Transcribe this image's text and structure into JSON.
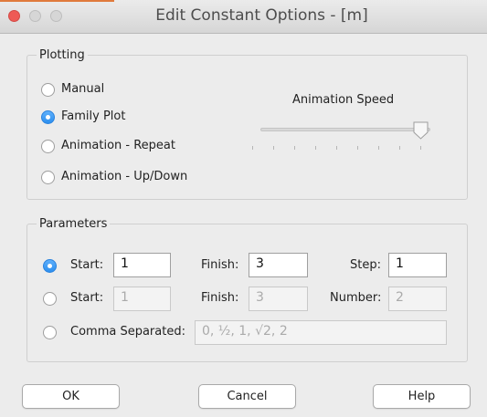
{
  "window": {
    "title": "Edit Constant Options - [m]"
  },
  "plotting": {
    "legend": "Plotting",
    "options": [
      {
        "label": "Manual",
        "checked": false
      },
      {
        "label": "Family Plot",
        "checked": true
      },
      {
        "label": "Animation - Repeat",
        "checked": false
      },
      {
        "label": "Animation - Up/Down",
        "checked": false
      }
    ],
    "animation_speed": {
      "label": "Animation Speed",
      "value": 1.0
    }
  },
  "parameters": {
    "legend": "Parameters",
    "row1": {
      "selected": true,
      "start_label": "Start:",
      "start_value": "1",
      "finish_label": "Finish:",
      "finish_value": "3",
      "step_label": "Step:",
      "step_value": "1"
    },
    "row2": {
      "selected": false,
      "start_label": "Start:",
      "start_value": "1",
      "finish_label": "Finish:",
      "finish_value": "3",
      "number_label": "Number:",
      "number_value": "2"
    },
    "row3": {
      "selected": false,
      "label": "Comma Separated:",
      "placeholder": "0, ½, 1, √2, 2"
    }
  },
  "buttons": {
    "ok": "OK",
    "cancel": "Cancel",
    "help": "Help"
  }
}
